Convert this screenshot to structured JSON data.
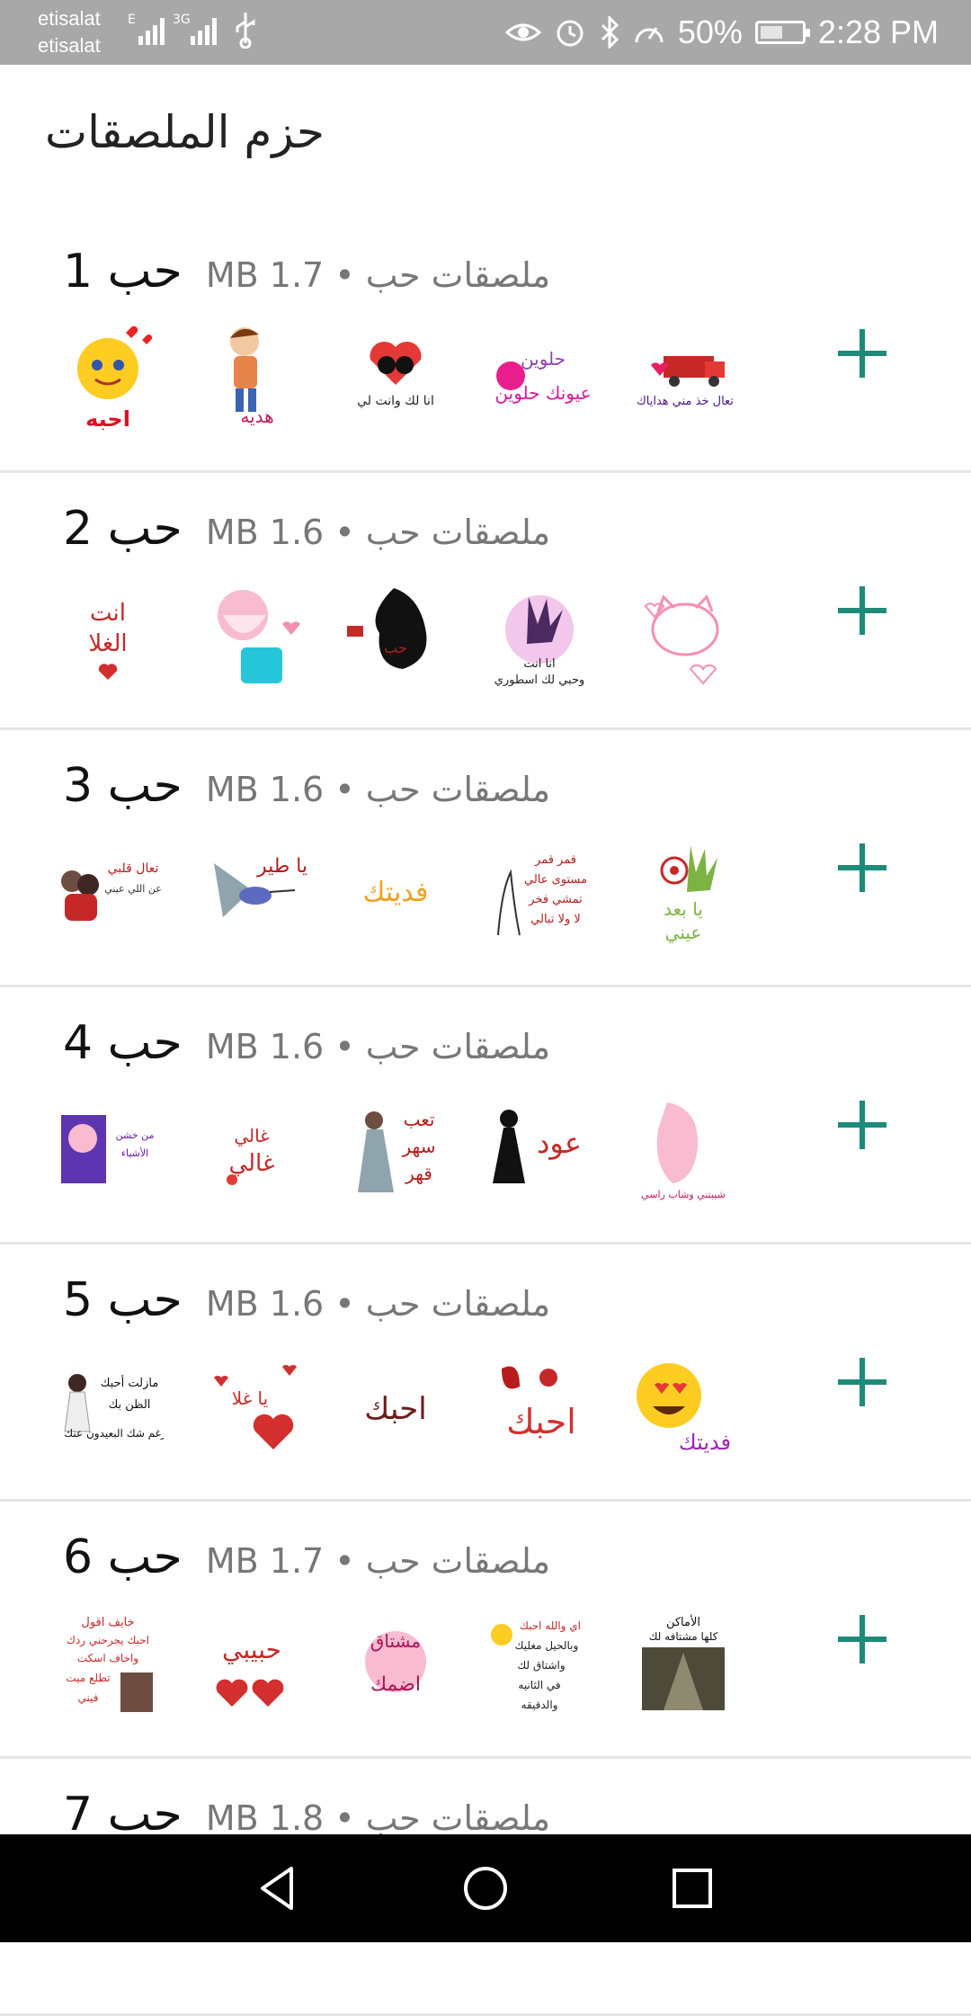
{
  "status_bar": {
    "carrier_top": "etisalat",
    "carrier_bottom": "etisalat",
    "battery": "50%",
    "battery_level": 0.5,
    "time": "2:28 PM",
    "icons": [
      "signal-icon",
      "signal-3g-icon",
      "usb-icon",
      "eye-icon",
      "alarm-icon",
      "bluetooth-icon",
      "speed-icon",
      "battery-icon"
    ]
  },
  "page": {
    "title": "حزم الملصقات"
  },
  "packs": [
    {
      "name": "حب 1",
      "meta": "ملصقات حب • 1.7 MB",
      "stickers": [
        "احبه",
        "هديه",
        "انا لك وانت لي",
        "حلوين عيونك حلوين",
        "تعال خذ مني هداياك"
      ]
    },
    {
      "name": "حب 2",
      "meta": "ملصقات حب • 1.6 MB",
      "stickers": [
        "انت الغلا",
        "",
        "",
        "انا انت وحبي لك اسطوري",
        ""
      ]
    },
    {
      "name": "حب 3",
      "meta": "ملصقات حب • 1.6 MB",
      "stickers": [
        "تعال قلبي",
        "يا طير",
        "فديتك",
        "قمر قمر",
        "يا بعد عيني"
      ]
    },
    {
      "name": "حب 4",
      "meta": "ملصقات حب • 1.6 MB",
      "stickers": [
        "",
        "",
        "تعب سهر قهر",
        "عود",
        ""
      ]
    },
    {
      "name": "حب 5",
      "meta": "ملصقات حب • 1.6 MB",
      "stickers": [
        "",
        "يا غلا",
        "احبك",
        "احبك",
        "فديتك"
      ]
    },
    {
      "name": "حب 6",
      "meta": "ملصقات حب • 1.7 MB",
      "stickers": [
        "خايف اقول",
        "حبيبي",
        "مشتاق",
        "اي والله احبك",
        "الأماكن"
      ]
    },
    {
      "name": "حب 7",
      "meta": "ملصقات حب • 1.8 MB",
      "stickers": []
    }
  ],
  "colors": {
    "accent": "#1e8a7a",
    "status_bar": "#a8a8a8",
    "nav_bar": "#000000"
  }
}
